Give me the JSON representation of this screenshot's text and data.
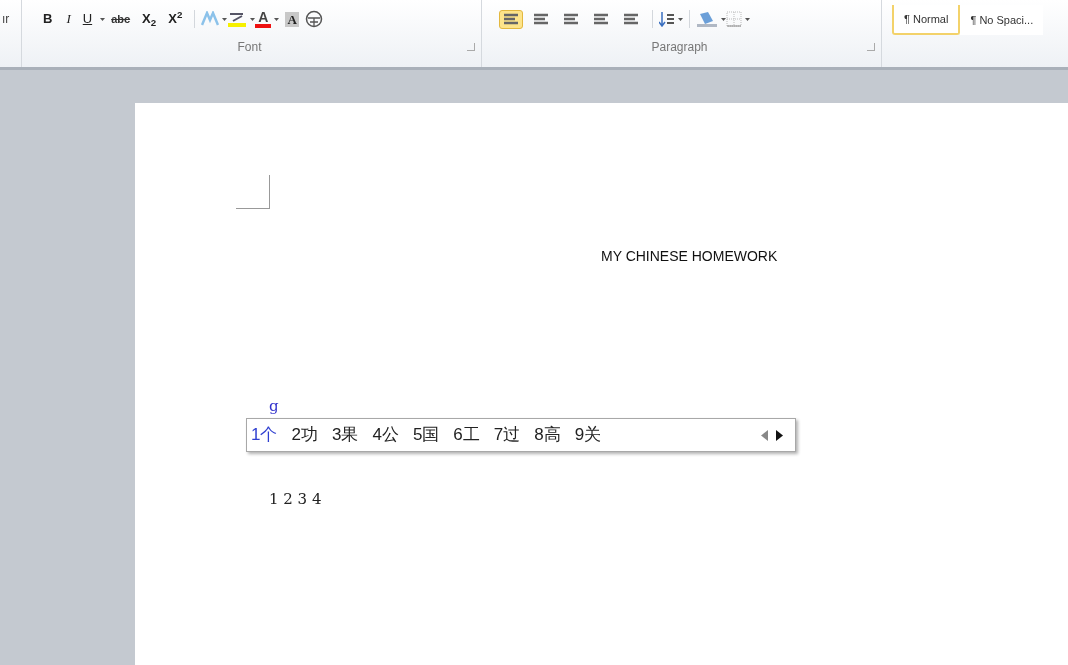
{
  "ribbon": {
    "cut_label": "ır",
    "font_group": {
      "label": "Font",
      "buttons": [
        {
          "kind": "bold",
          "text": "B"
        },
        {
          "kind": "italic",
          "text": "I"
        },
        {
          "kind": "underline",
          "text": "U",
          "dropdown": true
        },
        {
          "kind": "strike",
          "text": "abc"
        },
        {
          "kind": "sub",
          "text": "X",
          "sub": "2"
        },
        {
          "kind": "sup",
          "text": "X",
          "sub": "2"
        },
        {
          "kind": "sep"
        },
        {
          "kind": "effects",
          "dropdown": true
        },
        {
          "kind": "highlight",
          "dropdown": true
        },
        {
          "kind": "fontcolor",
          "text": "A",
          "dropdown": true
        },
        {
          "kind": "shading",
          "text": "A"
        },
        {
          "kind": "enclose"
        }
      ]
    },
    "paragraph_group": {
      "label": "Paragraph",
      "buttons": [
        {
          "kind": "align",
          "selected": true
        },
        {
          "kind": "align",
          "selected": false
        },
        {
          "kind": "align",
          "selected": false
        },
        {
          "kind": "align",
          "selected": false
        },
        {
          "kind": "align",
          "selected": false
        },
        {
          "kind": "sep"
        },
        {
          "kind": "linespacing",
          "dropdown": true
        },
        {
          "kind": "sep"
        },
        {
          "kind": "fill",
          "dropdown": true
        },
        {
          "kind": "borders",
          "dropdown": true
        }
      ]
    },
    "styles": [
      {
        "label": "¶ Normal",
        "selected": true
      },
      {
        "label": "¶ No Spaci...",
        "selected": false
      }
    ]
  },
  "document": {
    "title": "MY CHINESE HOMEWORK",
    "typed": "g",
    "line": "1 2 3 4"
  },
  "ime": {
    "candidates": [
      {
        "text": "1个",
        "selected": true
      },
      {
        "text": "2功",
        "selected": false
      },
      {
        "text": "3果",
        "selected": false
      },
      {
        "text": "4公",
        "selected": false
      },
      {
        "text": "5国",
        "selected": false
      },
      {
        "text": "6工",
        "selected": false
      },
      {
        "text": "7过",
        "selected": false
      },
      {
        "text": "8高",
        "selected": false
      },
      {
        "text": "9关",
        "selected": false
      }
    ]
  }
}
